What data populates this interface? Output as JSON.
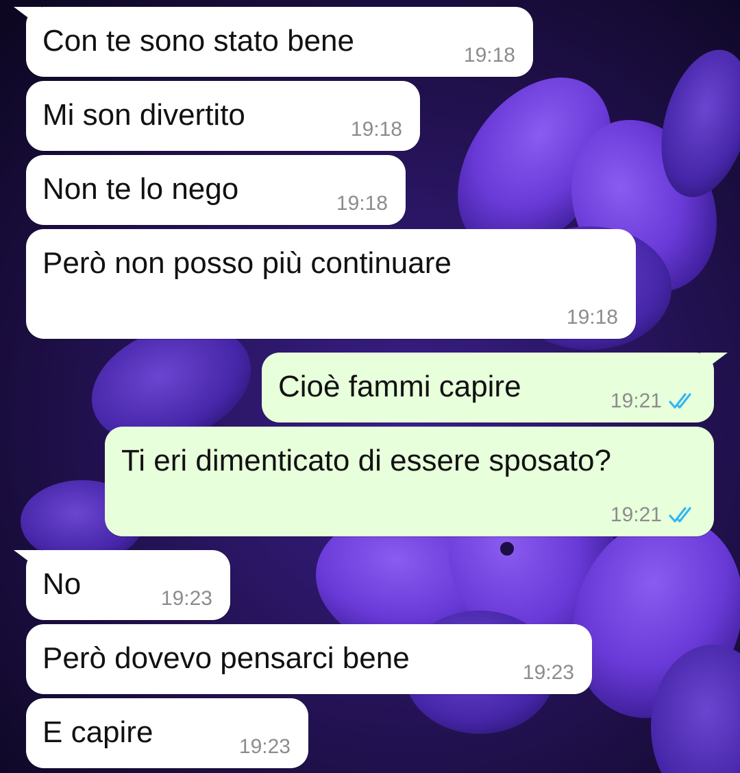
{
  "chat": {
    "messages": [
      {
        "direction": "incoming",
        "text": "Con te sono stato bene",
        "time": "19:18"
      },
      {
        "direction": "incoming",
        "text": "Mi son divertito",
        "time": "19:18"
      },
      {
        "direction": "incoming",
        "text": "Non te lo nego",
        "time": "19:18"
      },
      {
        "direction": "incoming",
        "text": "Però non posso più continuare",
        "time": "19:18"
      },
      {
        "direction": "outgoing",
        "text": "Cioè fammi capire",
        "time": "19:21",
        "status": "read"
      },
      {
        "direction": "outgoing",
        "text": "Ti eri dimenticato di essere sposato?",
        "time": "19:21",
        "status": "read"
      },
      {
        "direction": "incoming",
        "text": "No",
        "time": "19:23"
      },
      {
        "direction": "incoming",
        "text": "Però dovevo pensarci bene",
        "time": "19:23"
      },
      {
        "direction": "incoming",
        "text": "E capire",
        "time": "19:23"
      }
    ]
  },
  "theme": {
    "incoming_bubble": "#ffffff",
    "outgoing_bubble": "#e7ffdb",
    "time_color": "#8c8c8c",
    "read_tick_color": "#34b7f1",
    "wallpaper": "purple-flowers"
  }
}
